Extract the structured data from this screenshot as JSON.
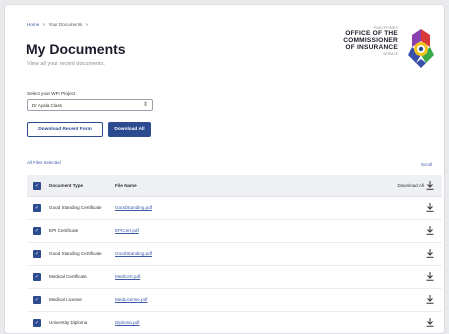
{
  "breadcrumb": {
    "home": "Home",
    "separator": ">",
    "current": "Your Documents",
    "trailing": ">"
  },
  "header": {
    "title": "My Documents",
    "subtitle": "View all your recent documents."
  },
  "branding": {
    "org_small": "PHILIPPINES",
    "org_line1": "OFFICE OF THE",
    "org_line2": "COMMISSIONER",
    "org_line3": "OF INSURANCE",
    "org_service": "SERVICE",
    "emblem_colors": {
      "blue": "#3a4fa8",
      "yellow": "#f2c31b",
      "green": "#39a94a",
      "red": "#d83a3a",
      "purple": "#8b3fb0"
    }
  },
  "project_select": {
    "label": "Select your WFI Project",
    "value": "Dr Ayala Class"
  },
  "actions": {
    "download_recent": "Download Recent Form",
    "download_all": "Download All"
  },
  "selection": {
    "files_selected": "All Files Selected",
    "scroll_label": "Scroll"
  },
  "table": {
    "headers": {
      "type": "Document Type",
      "name": "File Name",
      "download": "Download All"
    },
    "rows": [
      {
        "type": "Good Standing Certificate",
        "name": "GoodStanding.pdf"
      },
      {
        "type": "EPI Certificate",
        "name": "EPICert.pdf"
      },
      {
        "type": "Good Standing Certificate",
        "name": "GoodStanding.pdf"
      },
      {
        "type": "Medical Certificate",
        "name": "MedCert.pdf"
      },
      {
        "type": "Medical License",
        "name": "MedLicense.pdf"
      },
      {
        "type": "University Diploma",
        "name": "Diploma.pdf"
      }
    ]
  },
  "colors": {
    "primary": "#2b4a8f",
    "link": "#3a5aa8",
    "header_bg": "#eef0f3"
  }
}
